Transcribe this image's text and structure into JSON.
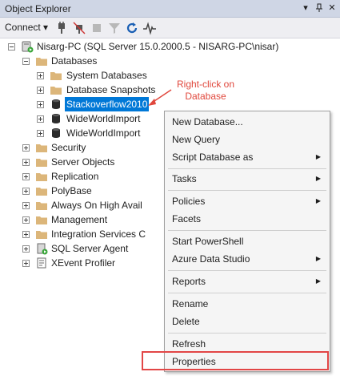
{
  "window": {
    "title": "Object Explorer",
    "pin_icon": "pin-icon",
    "close_icon": "close-icon",
    "dropdown_icon": "dropdown-arrow-icon"
  },
  "toolbar": {
    "connect_label": "Connect",
    "icons": [
      "connect-server-icon",
      "disconnect-icon",
      "stop-icon",
      "filter-icon",
      "refresh-icon",
      "activity-monitor-icon"
    ]
  },
  "tree": {
    "server": "Nisarg-PC (SQL Server 15.0.2000.5 - NISARG-PC\\nisar)",
    "databases": "Databases",
    "system_databases": "System Databases",
    "database_snapshots": "Database Snapshots",
    "db_selected": "Stackoverflow2010",
    "db_wwi1": "WideWorldImport",
    "db_wwi2": "WideWorldImport",
    "security": "Security",
    "server_objects": "Server Objects",
    "replication": "Replication",
    "polybase": "PolyBase",
    "always_on": "Always On High Avail",
    "management": "Management",
    "integration_services": "Integration Services C",
    "sql_agent": "SQL Server Agent",
    "xevent_profiler": "XEvent Profiler"
  },
  "annotation": {
    "line1": "Right-click on",
    "line2": "Database",
    "color": "#e0473c"
  },
  "context_menu": {
    "new_database": "New Database...",
    "new_query": "New Query",
    "script_database_as": "Script Database as",
    "tasks": "Tasks",
    "policies": "Policies",
    "facets": "Facets",
    "start_powershell": "Start PowerShell",
    "azure_data_studio": "Azure Data Studio",
    "reports": "Reports",
    "rename": "Rename",
    "delete": "Delete",
    "refresh": "Refresh",
    "properties": "Properties",
    "submenu_arrow": "▶",
    "highlight_color": "#e24646"
  },
  "colors": {
    "selection": "#0078d7",
    "folder": "#dcb67a"
  }
}
